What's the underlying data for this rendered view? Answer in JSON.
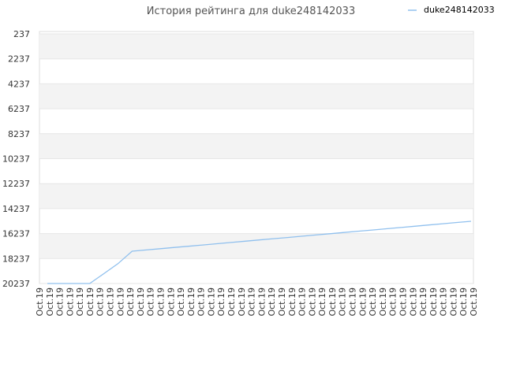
{
  "chart_data": {
    "type": "line",
    "title": "История рейтинга для duke248142033",
    "xlabel": "",
    "ylabel": "",
    "y_inverted": true,
    "ylim": [
      237,
      20237
    ],
    "y_ticks": [
      237,
      2237,
      4237,
      6237,
      8237,
      10237,
      12237,
      14237,
      16237,
      18237,
      20237
    ],
    "x_tick_label": "Oct.19",
    "x_tick_count": 44,
    "grid": "horizontal bands",
    "legend_position": "top-right",
    "series": [
      {
        "name": "duke248142033",
        "color": "#90c0ee",
        "values": [
          20237,
          20237,
          20237,
          20237,
          19450,
          18650,
          17650,
          17550,
          17450,
          17350,
          17250,
          17150,
          17050,
          16950,
          16850,
          16750,
          16650,
          16550,
          16450,
          16350,
          16250,
          16150,
          16050,
          15950,
          15850,
          15750,
          15650,
          15550,
          15450,
          15350,
          15250
        ]
      }
    ]
  },
  "colors": {
    "band": "#f3f3f3",
    "grid": "#e6e6e6",
    "axis": "#dddddd"
  }
}
